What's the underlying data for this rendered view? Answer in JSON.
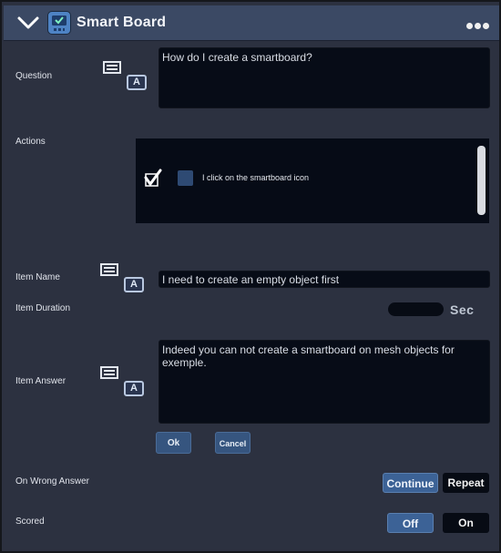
{
  "header": {
    "title": "Smart Board"
  },
  "question": {
    "label": "Question",
    "value": "How do I create a smartboard?"
  },
  "actions": {
    "label": "Actions",
    "items": [
      {
        "text": "I click on the smartboard icon",
        "checked": true
      }
    ]
  },
  "item_name": {
    "label": "Item Name",
    "value": "I need to create an empty object first"
  },
  "item_duration": {
    "label": "Item Duration",
    "value": "",
    "unit": "Sec"
  },
  "item_answer": {
    "label": "Item Answer",
    "value": "Indeed you can not create a smartboard on mesh objects for exemple."
  },
  "buttons": {
    "ok": "Ok",
    "cancel": "Cancel"
  },
  "on_wrong_answer": {
    "label": "On Wrong Answer",
    "options": [
      "Continue",
      "Repeat"
    ],
    "selected": "Continue"
  },
  "scored": {
    "label": "Scored",
    "options": [
      "Off",
      "On"
    ],
    "selected": "Off"
  },
  "icons": [
    "chevron-down-icon",
    "smartboard-app-icon",
    "more-options-icon",
    "notes-icon",
    "text-format-icon",
    "checkmark-icon"
  ],
  "colors": {
    "header": "#3b4964",
    "panel": "#2c3140",
    "field": "#070c17",
    "accent": "#36557f"
  }
}
